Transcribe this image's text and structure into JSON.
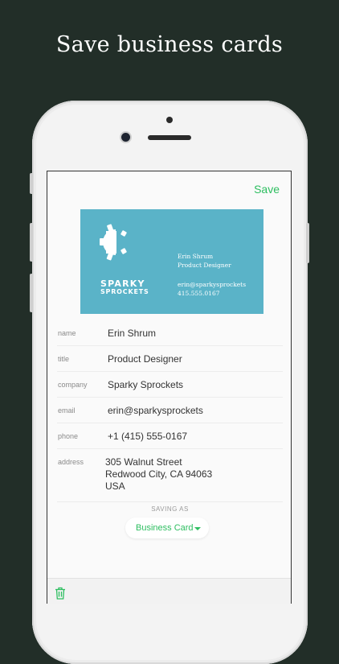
{
  "headline": "Save business cards",
  "toolbar": {
    "save_label": "Save"
  },
  "card": {
    "brand_line1": "SPARKY",
    "brand_line2": "SPROCKETS",
    "name": "Erin Shrum",
    "title": "Product Designer",
    "email": "erin@sparkysprockets",
    "phone": "415.555.0167",
    "background_color": "#5ab3c8"
  },
  "fields": [
    {
      "label": "name",
      "value": "Erin Shrum"
    },
    {
      "label": "title",
      "value": "Product Designer"
    },
    {
      "label": "company",
      "value": "Sparky Sprockets"
    },
    {
      "label": "email",
      "value": "erin@sparkysprockets"
    },
    {
      "label": "phone",
      "value": "+1 (415) 555-0167"
    },
    {
      "label": "address",
      "value_lines": [
        "305 Walnut Street",
        "Redwood City, CA 94063",
        "USA"
      ]
    }
  ],
  "saving": {
    "label": "SAVING AS",
    "selected": "Business Card"
  },
  "bottom_bar": {
    "icon": "trash-icon"
  },
  "colors": {
    "accent": "#2dbe60",
    "background": "#222e28"
  }
}
